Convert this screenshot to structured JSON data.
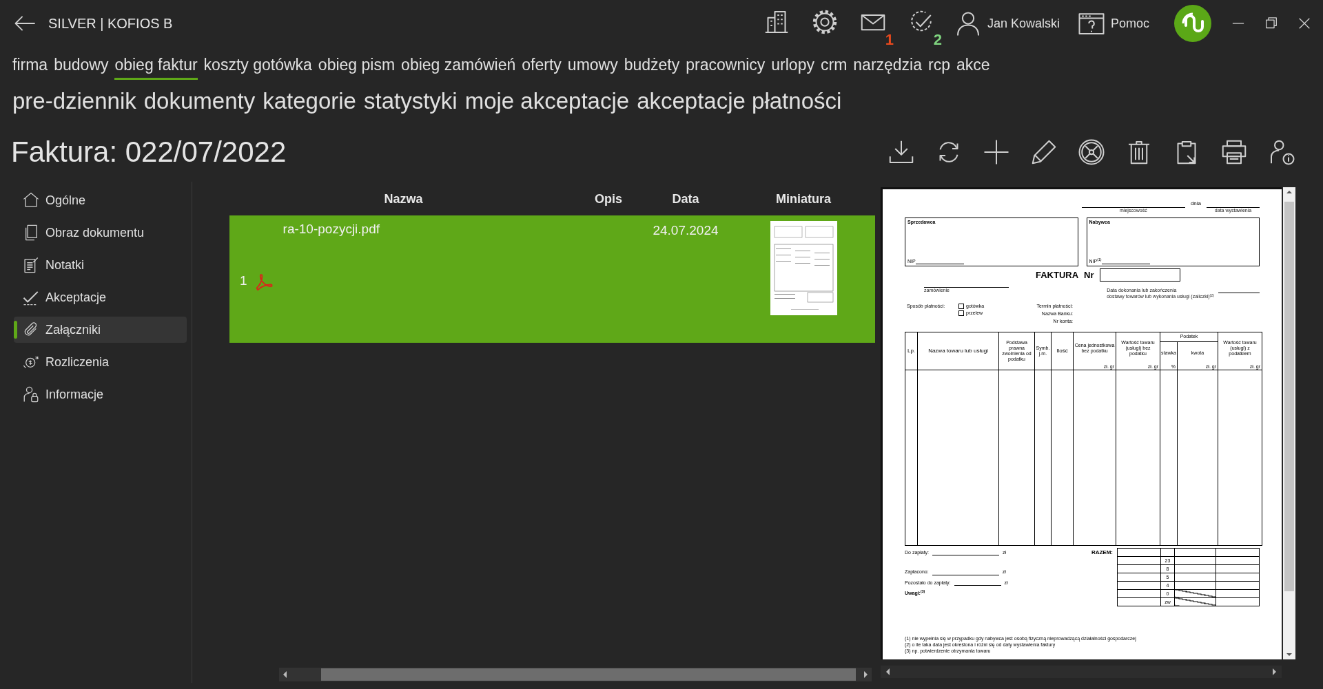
{
  "header": {
    "app_title": "SILVER | KOFIOS B",
    "notifications": [
      {
        "count": "1",
        "color": "#e8491d"
      },
      {
        "count": "2",
        "color": "#7fd37f"
      }
    ],
    "user_name": "Jan Kowalski",
    "help_label": "Pomoc"
  },
  "tabs": [
    {
      "label": "firma",
      "selected": false
    },
    {
      "label": "budowy",
      "selected": false
    },
    {
      "label": "obieg faktur",
      "selected": true
    },
    {
      "label": "koszty gotówka",
      "selected": false
    },
    {
      "label": "obieg pism",
      "selected": false
    },
    {
      "label": "obieg zamówień",
      "selected": false
    },
    {
      "label": "oferty",
      "selected": false
    },
    {
      "label": "umowy",
      "selected": false
    },
    {
      "label": "budżety",
      "selected": false
    },
    {
      "label": "pracownicy",
      "selected": false
    },
    {
      "label": "urlopy",
      "selected": false
    },
    {
      "label": "crm",
      "selected": false
    },
    {
      "label": "narzędzia",
      "selected": false
    },
    {
      "label": "rcp",
      "selected": false
    },
    {
      "label": "akce",
      "selected": false
    }
  ],
  "subtabs": [
    "pre-dziennik",
    "dokumenty",
    "kategorie",
    "statystyki",
    "moje akceptacje",
    "akceptacje płatności"
  ],
  "page_title": "Faktura: 022/07/2022",
  "sidebar": {
    "items": [
      {
        "label": "Ogólne",
        "selected": false
      },
      {
        "label": "Obraz dokumentu",
        "selected": false
      },
      {
        "label": "Notatki",
        "selected": false
      },
      {
        "label": "Akceptacje",
        "selected": false
      },
      {
        "label": "Załączniki",
        "selected": true
      },
      {
        "label": "Rozliczenia",
        "selected": false
      },
      {
        "label": "Informacje",
        "selected": false
      }
    ]
  },
  "table": {
    "columns": [
      "Nazwa",
      "Opis",
      "Data",
      "Miniatura"
    ],
    "rows": [
      {
        "index": "1",
        "name": "ra-10-pozycji.pdf",
        "date": "24.07.2024",
        "selected": true
      }
    ]
  },
  "preview": {
    "place_label": "miejscowość",
    "date_word": "dnia",
    "issue_label": "data wystawienia",
    "seller": "Sprzedawca",
    "buyer": "Nabywca",
    "seller_nip": "NIP",
    "buyer_nip": "NIP$^{(1)}$",
    "title": "FAKTURA",
    "number_label": "Nr",
    "order_label": "zamówienie",
    "delivery_label": [
      "Data dokonania lub zakończenia",
      "dostawy towarów lub wykonania usługi (zaliczki)$^{(2)}$"
    ],
    "payment_label": "Sposób płatności:",
    "payment_options": [
      {
        "label": "gotówka",
        "checked": false
      },
      {
        "label": "przelew",
        "checked": false
      }
    ],
    "payment_fields": [
      "Termin płatności:",
      "Nazwa Banku:",
      "Nr konta:"
    ],
    "columns": [
      {
        "label": "Lp.",
        "kind": "big"
      },
      {
        "label": "Nazwa towaru lub usługi",
        "kind": "big"
      },
      {
        "label": "Podstawa prawna zwolnienia od podatku",
        "kind": "small"
      },
      {
        "label": "Symb. j.m.",
        "kind": "small"
      },
      {
        "label": "Ilość",
        "kind": "big"
      },
      {
        "label": "Cena jednostkowa bez podatku",
        "kind": "small",
        "unit": "zł. gr"
      },
      {
        "label": "Wartość towaru (usługi) bez podatku",
        "kind": "small",
        "unit": "zł. gr"
      },
      {
        "label": "Podatek",
        "kind": "group",
        "children": [
          {
            "label": "stawka",
            "unit": "%"
          },
          {
            "label": "kwota",
            "unit": "zł. gr"
          }
        ]
      },
      {
        "label": "Wartość towaru (usługi) z podatkiem",
        "kind": "small",
        "unit": "zł. gr"
      }
    ],
    "payments": [
      {
        "label": "Do zapłaty:",
        "currency": "zł"
      },
      {
        "label": "Zapłacono:",
        "currency": "zł"
      },
      {
        "label": "Pozostało do zapłaty:",
        "currency": "zł"
      }
    ],
    "notes_label": "Uwagi:$^{(3)}$",
    "total_label": "RAZEM:",
    "rates": [
      {
        "rate": "23",
        "crossed": false
      },
      {
        "rate": "8",
        "crossed": false
      },
      {
        "rate": "5",
        "crossed": false
      },
      {
        "rate": "4",
        "crossed": false
      },
      {
        "rate": "0",
        "crossed": true
      },
      {
        "rate": "zw",
        "crossed": true
      }
    ],
    "footnotes": [
      "(1) nie wypełnia się w przypadku gdy nabywca jest osobą fizyczną nieprowadzącą działalności gospodarczej",
      "(2) o ile taka data jest określona i różni się od daty wystawienia faktury",
      "(3) np. potwierdzenie otrzymania towaru"
    ]
  }
}
